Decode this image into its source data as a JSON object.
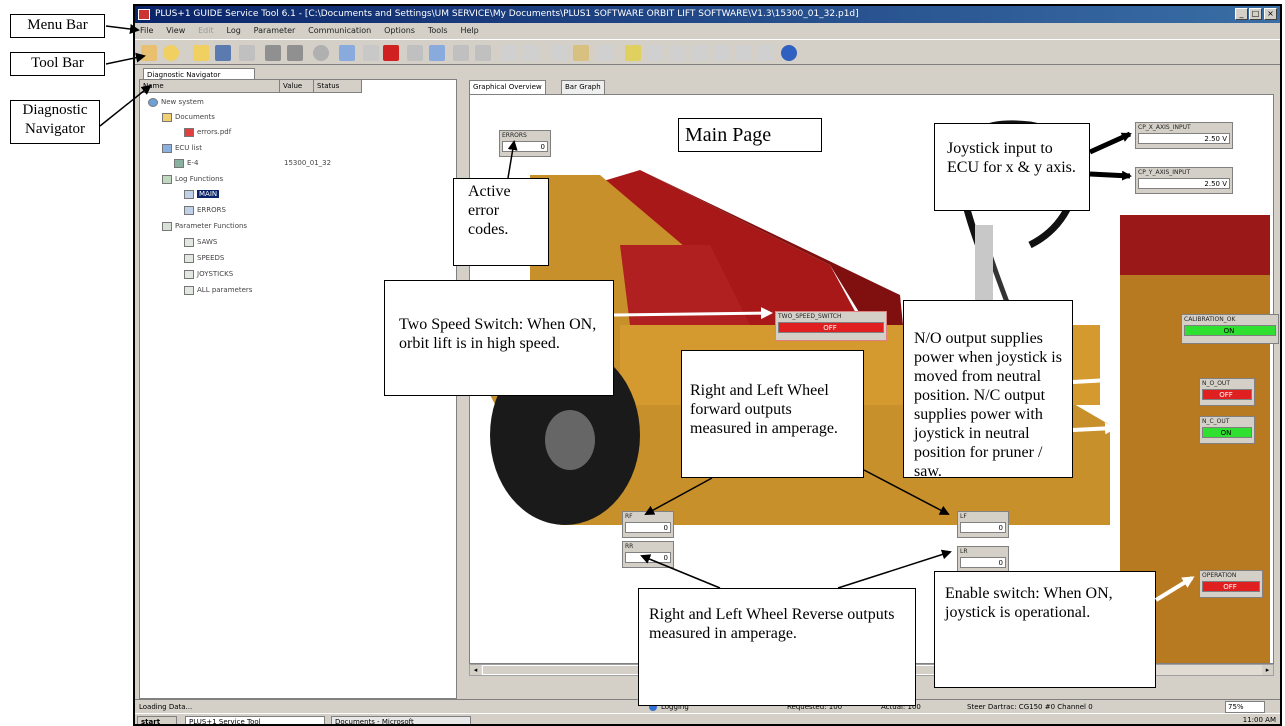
{
  "side_labels": {
    "menu_bar": "Menu Bar",
    "tool_bar": "Tool Bar",
    "diagnostic_navigator": "Diagnostic Navigator"
  },
  "window": {
    "title": "PLUS+1 GUIDE Service Tool 6.1 - [C:\\Documents and Settings\\UM SERVICE\\My Documents\\PLUS1 SOFTWARE ORBIT LIFT SOFTWARE\\V1.3\\15300_01_32.p1d]",
    "menu": [
      "File",
      "View",
      "Edit",
      "Log",
      "Parameter",
      "Communication",
      "Options",
      "Tools",
      "Help"
    ]
  },
  "navigator": {
    "tab": "Diagnostic Navigator",
    "columns": [
      "Name",
      "Value",
      "Status"
    ],
    "tree": [
      {
        "label": "New system",
        "value": ""
      },
      {
        "label": "Documents",
        "value": ""
      },
      {
        "label": "errors.pdf",
        "value": ""
      },
      {
        "label": "ECU list",
        "value": ""
      },
      {
        "label": "E-4",
        "value": "15300_01_32"
      },
      {
        "label": "Log Functions",
        "value": ""
      },
      {
        "label": "MAIN",
        "value": ""
      },
      {
        "label": "ERRORS",
        "value": ""
      },
      {
        "label": "Parameter Functions",
        "value": ""
      },
      {
        "label": "SAWS",
        "value": ""
      },
      {
        "label": "SPEEDS",
        "value": ""
      },
      {
        "label": "JOYSTICKS",
        "value": ""
      },
      {
        "label": "ALL parameters",
        "value": ""
      }
    ]
  },
  "graphical": {
    "tabs": [
      "Graphical Overview",
      "Bar Graph"
    ],
    "page_label": "Main Page",
    "signals": {
      "errors": {
        "name": "ERRORS",
        "value": "0"
      },
      "joy_x": {
        "name": "CP_X_AXIS_INPUT",
        "value": "2.50 V"
      },
      "joy_y": {
        "name": "CP_Y_AXIS_INPUT",
        "value": "2.50 V"
      },
      "two_speed": {
        "name": "TWO_SPEED_SWITCH",
        "value": "OFF"
      },
      "calibration": {
        "name": "CALIBRATION_OK",
        "value": "ON"
      },
      "no_out": {
        "name": "N_O_OUT",
        "value": "OFF"
      },
      "nc_out": {
        "name": "N_C_OUT",
        "value": "ON"
      },
      "rf": {
        "name": "RF",
        "value": "0"
      },
      "rr": {
        "name": "RR",
        "value": "0"
      },
      "lf": {
        "name": "LF",
        "value": "0"
      },
      "lr": {
        "name": "LR",
        "value": "0"
      },
      "operation": {
        "name": "OPERATION",
        "value": "OFF"
      }
    }
  },
  "callouts": {
    "active_errors": "Active error codes.",
    "joystick_input": "Joystick input to ECU for x & y axis.",
    "two_speed": "Two Speed Switch: When ON, orbit lift is in high speed.",
    "outputs": "N/O output supplies power when joystick is moved from neutral position. N/C output supplies power with joystick in neutral position for pruner / saw.",
    "forward": "Right and Left Wheel forward outputs measured in amperage.",
    "reverse": "Right and Left Wheel Reverse outputs measured in amperage.",
    "enable": "Enable switch: When ON, joystick is operational."
  },
  "status": {
    "left": "Loading Data...",
    "logging": "Logging",
    "requested": "Requested: 100",
    "actual": "Actual: 100",
    "driver": "Steer Dartrac: CG150 #0 Channel 0",
    "zoom": "75%"
  },
  "taskbar": {
    "start": "start",
    "task1": "PLUS+1 Service Tool",
    "task2": "Documents - Microsoft",
    "clock": "11:00 AM"
  },
  "colors": {
    "title_bg": "#0a246a",
    "output_off": "#e02020",
    "output_on": "#30e030",
    "machine": "#c8902a",
    "boom": "#a01818"
  }
}
